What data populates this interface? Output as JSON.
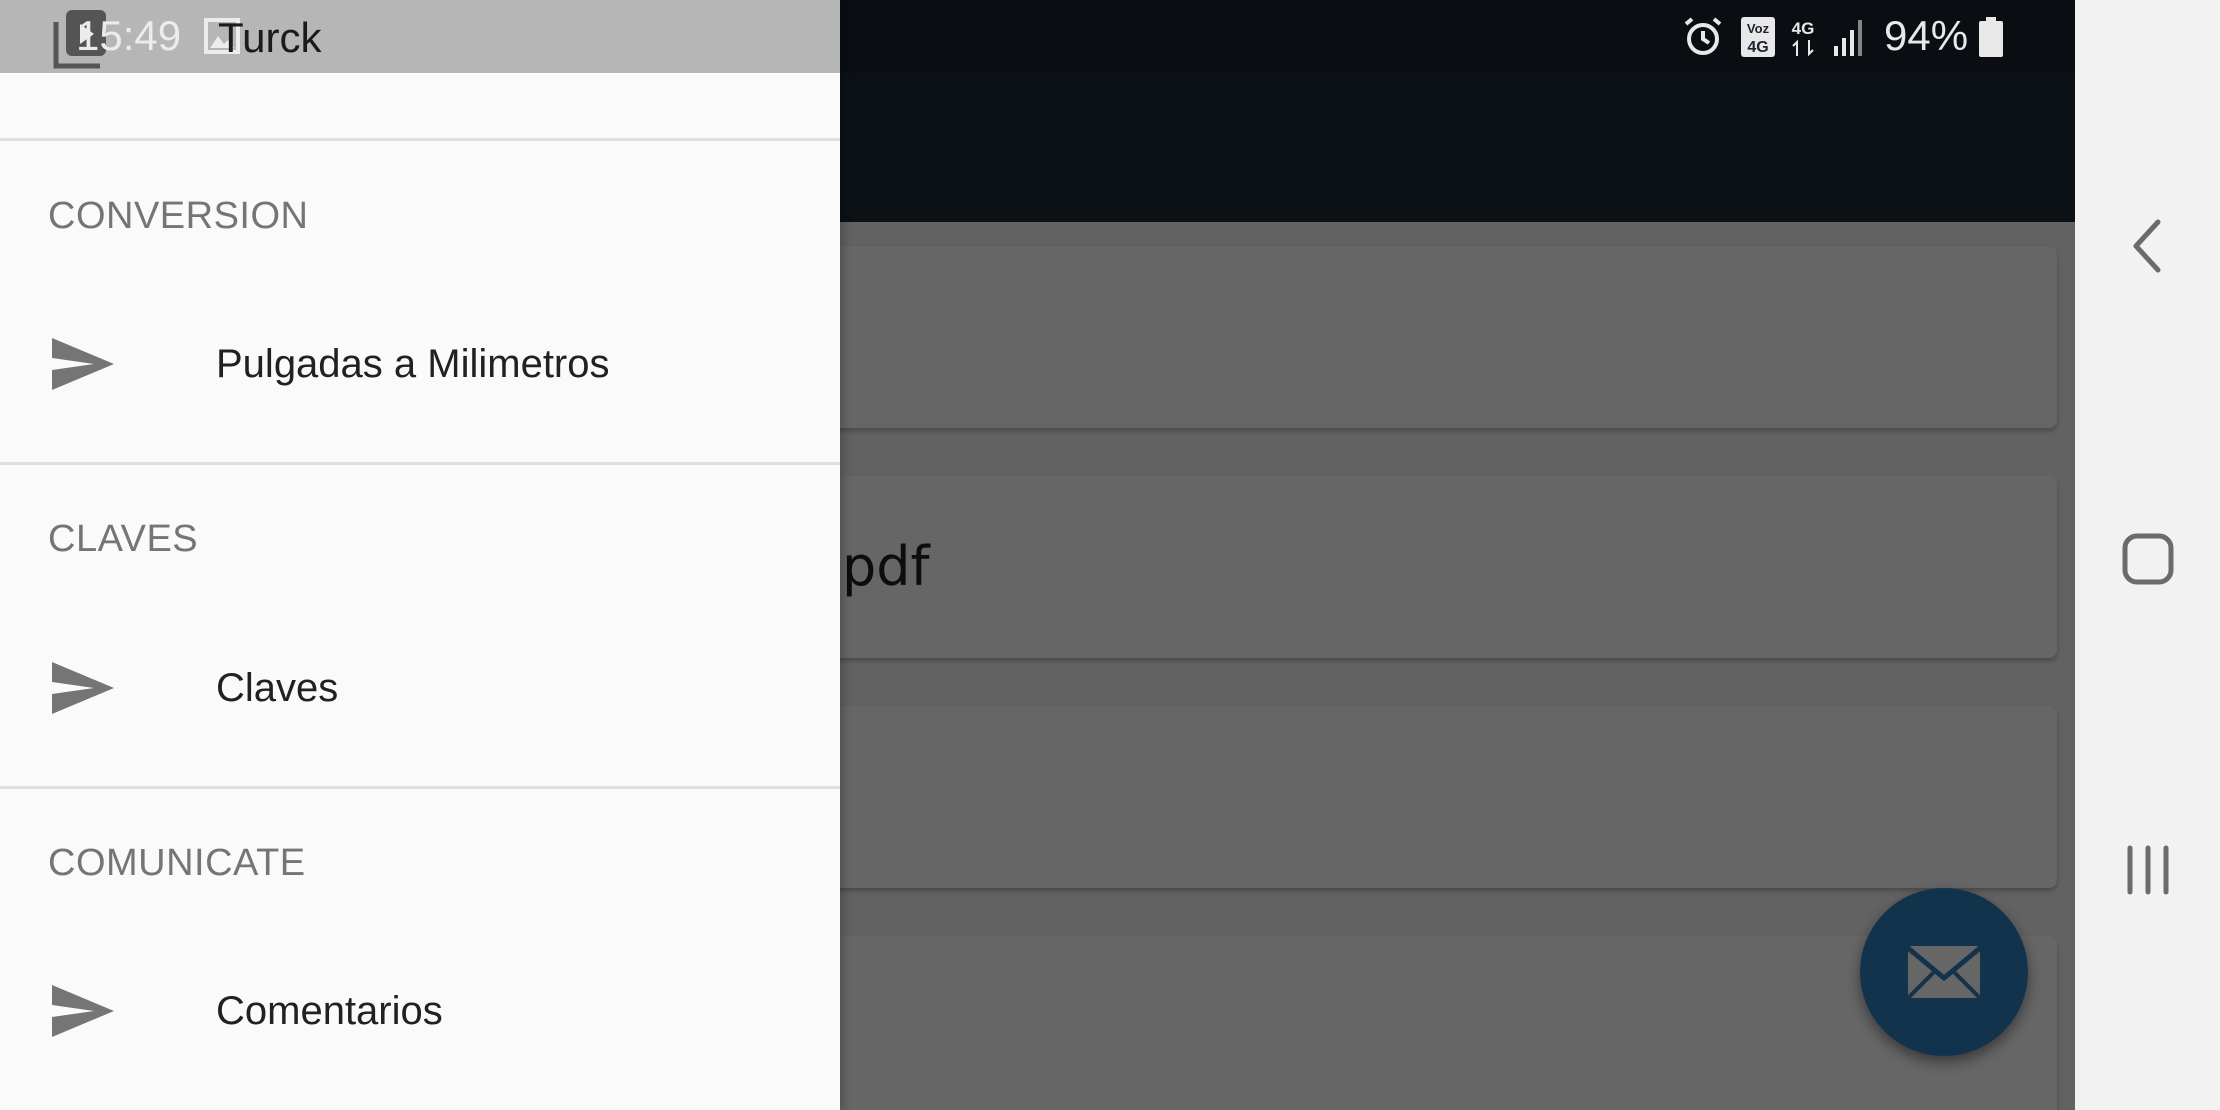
{
  "status_bar": {
    "time": "15:49",
    "app_title": "Turck",
    "battery": "94%",
    "network": "4G",
    "volte": "Voz 4G",
    "icons": [
      "alarm-icon",
      "volte-icon",
      "4g-icon",
      "signal-icon",
      "battery-icon"
    ]
  },
  "background": {
    "cards": [
      {
        "text": ""
      },
      {
        "text": "pdf"
      },
      {
        "text": ""
      },
      {
        "text": ""
      }
    ],
    "fab_icon": "email-icon"
  },
  "drawer": {
    "sections": [
      {
        "header": "CONVERSION",
        "items": [
          {
            "label": "Pulgadas a Milimetros",
            "icon": "send-icon"
          }
        ]
      },
      {
        "header": "CLAVES",
        "items": [
          {
            "label": "Claves",
            "icon": "send-icon"
          }
        ]
      },
      {
        "header": "COMUNICATE",
        "items": [
          {
            "label": "Comentarios",
            "icon": "send-icon"
          }
        ]
      }
    ]
  },
  "system_nav": {
    "buttons": [
      "back-icon",
      "home-icon",
      "recents-icon"
    ]
  },
  "colors": {
    "toolbar": "#1f2b37",
    "fab": "#2e7fbf",
    "drawer_bg": "#fafafa",
    "section_header": "#757575",
    "nav_label": "#212121"
  }
}
